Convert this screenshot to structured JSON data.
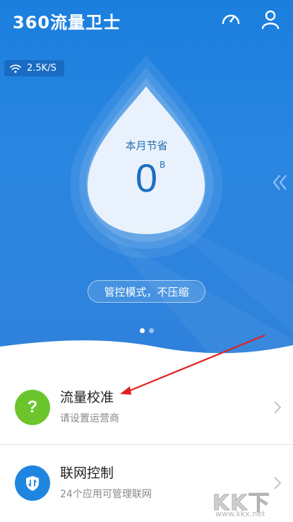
{
  "app": {
    "brand": "360流量卫士"
  },
  "header": {
    "icons": [
      "speedometer-icon",
      "user-icon"
    ]
  },
  "speed": {
    "text": "2.5K/S",
    "icon": "wifi-icon"
  },
  "savings": {
    "label": "本月节省",
    "value": "0",
    "unit": "B"
  },
  "mode": {
    "label": "管控模式，不压缩"
  },
  "pager": {
    "count": 2,
    "active": 0
  },
  "cards": [
    {
      "title": "流量校准",
      "subtitle": "请设置运营商",
      "icon": "question-icon",
      "color": "#6cc52c"
    },
    {
      "title": "联网控制",
      "subtitle": "24个应用可管理联网",
      "icon": "shield-icon",
      "color": "#1f86e0"
    }
  ],
  "watermark": {
    "text": "KK下载",
    "url": "www.kkx.net"
  },
  "colors": {
    "primary": "#1b7fde",
    "accent_green": "#6cc52c",
    "annotation_red": "#e02020"
  }
}
